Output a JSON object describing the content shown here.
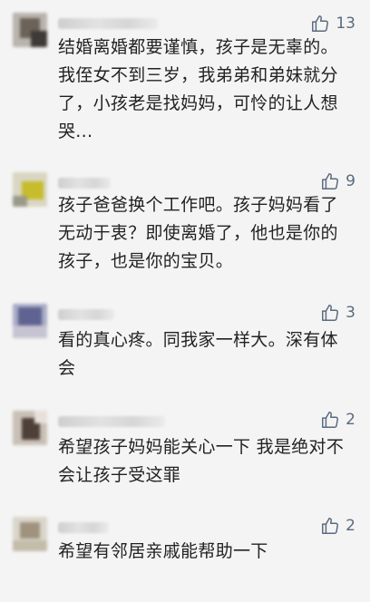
{
  "comments": [
    {
      "likes": "13",
      "text": "结婚离婚都要谨慎，孩子是无辜的。我侄女不到三岁，我弟弟和弟妹就分了，小孩老是找妈妈，可怜的让人想哭..."
    },
    {
      "likes": "9",
      "text": "孩子爸爸换个工作吧。孩子妈妈看了无动于衷？即使离婚了，他也是你的孩子，也是你的宝贝。"
    },
    {
      "likes": "3",
      "text": "看的真心疼。同我家一样大。深有体会"
    },
    {
      "likes": "2",
      "text": "希望孩子妈妈能关心一下 我是绝对不会让孩子受这罪"
    },
    {
      "likes": "2",
      "text": "希望有邻居亲戚能帮助一下"
    }
  ],
  "icons": {
    "like": "thumbs-up-icon"
  },
  "colors": {
    "background": "#f4f4f4",
    "text": "#222222",
    "like": "#5a6a7e"
  }
}
